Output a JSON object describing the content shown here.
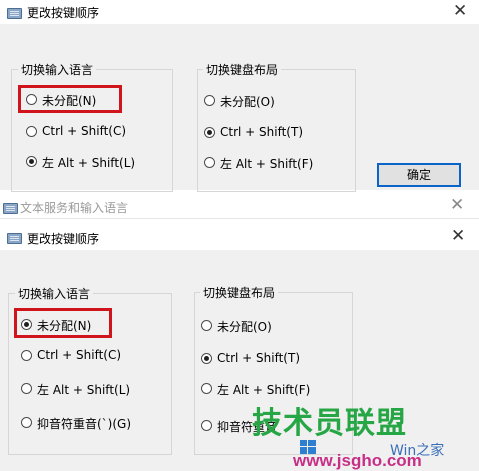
{
  "top_dialog": {
    "title": "更改按键顺序",
    "close_glyph": "✕",
    "group_language": {
      "label": "切换输入语言",
      "options": [
        {
          "label": "未分配(N)",
          "selected": false
        },
        {
          "label": "Ctrl + Shift(C)",
          "selected": false
        },
        {
          "label": "左 Alt + Shift(L)",
          "selected": true
        }
      ]
    },
    "group_layout": {
      "label": "切换键盘布局",
      "options": [
        {
          "label": "未分配(O)",
          "selected": false
        },
        {
          "label": "Ctrl + Shift(T)",
          "selected": true
        },
        {
          "label": "左 Alt + Shift(F)",
          "selected": false
        }
      ]
    },
    "ok_label": "确定"
  },
  "background_window": {
    "title": "文本服务和输入语言",
    "close_glyph": "✕"
  },
  "bottom_dialog": {
    "title": "更改按键顺序",
    "close_glyph": "✕",
    "group_language": {
      "label": "切换输入语言",
      "options": [
        {
          "label": "未分配(N)",
          "selected": true
        },
        {
          "label": "Ctrl + Shift(C)",
          "selected": false
        },
        {
          "label": "左 Alt + Shift(L)",
          "selected": false
        },
        {
          "label": "抑音符重音(`)(G)",
          "selected": false
        }
      ]
    },
    "group_layout": {
      "label": "切换键盘布局",
      "options": [
        {
          "label": "未分配(O)",
          "selected": false
        },
        {
          "label": "Ctrl + Shift(T)",
          "selected": true
        },
        {
          "label": "左 Alt + Shift(F)",
          "selected": false
        },
        {
          "label": "抑音符重音",
          "selected": false
        }
      ]
    }
  },
  "watermark": {
    "brand": "技术员联盟",
    "url": "www.jsgho.com",
    "tail": "Win之家"
  },
  "colors": {
    "dialog_bg": "#f0f0f0",
    "highlight_red": "#d0141c",
    "button_focus_blue": "#0a64c8",
    "watermark_green": "#27a645",
    "watermark_magenta": "#c72f86"
  }
}
